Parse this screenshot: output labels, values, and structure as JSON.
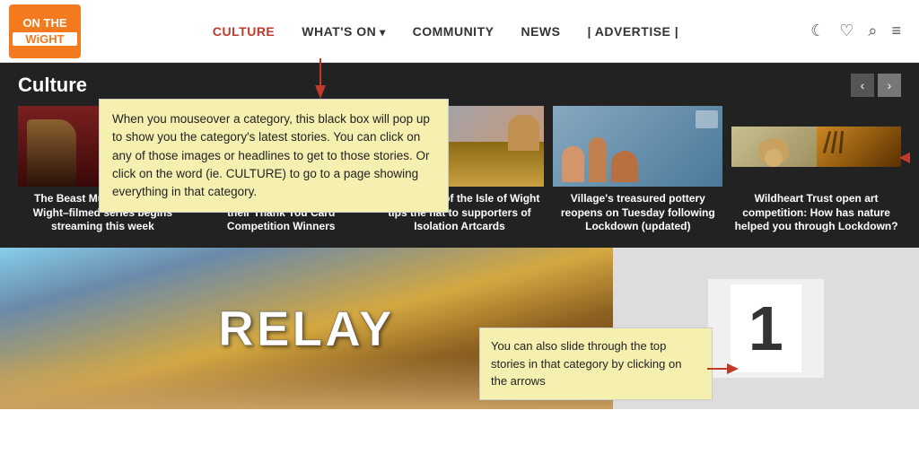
{
  "logo": {
    "line1": "ON THE",
    "line2": "WiGHT"
  },
  "nav": {
    "items": [
      {
        "label": "CULTURE",
        "active": true,
        "hasArrow": false
      },
      {
        "label": "WHAT'S ON",
        "active": false,
        "hasArrow": true
      },
      {
        "label": "COMMUNITY",
        "active": false,
        "hasArrow": false
      },
      {
        "label": "NEWS",
        "active": false,
        "hasArrow": false
      },
      {
        "label": "| ADVERTISE |",
        "active": false,
        "hasArrow": false
      }
    ],
    "icons": [
      "☾",
      "♡",
      "🔍",
      "≡"
    ]
  },
  "culture": {
    "title": "Culture",
    "tooltip": "When you mouseover a category, this black box will pop up to show you the category's latest stories. You can click on any of those images or headlines to get to those stories. Or click on the word (ie. CULTURE) to go to a page showing everything in that category.",
    "tooltip2": "You can also slide through the top stories in that category by clicking on the arrows",
    "stories": [
      {
        "caption": "The Beast Must Die: Isle of Wight–filmed series begins streaming this week",
        "thumbType": "person"
      },
      {
        "caption": "Independent Arts announced their Thank You Card Competition Winners",
        "thumbType": "interior"
      },
      {
        "caption": "Steve's tour of the Isle of Wight tips the hat to supporters of Isolation Artcards",
        "thumbType": "pottery"
      },
      {
        "caption": "Village's treasured pottery reopens on Tuesday following Lockdown (updated)",
        "thumbType": "pottery2"
      },
      {
        "caption": "Wildheart Trust open art competition: How has nature helped you through Lockdown?",
        "thumbType": "animals"
      }
    ],
    "prevArrow": "‹",
    "nextArrow": "›"
  },
  "bottom": {
    "relayText": "RELAY",
    "numberText": "1"
  }
}
